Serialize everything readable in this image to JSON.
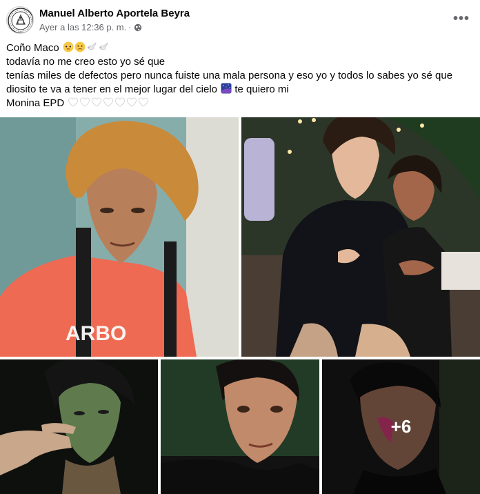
{
  "post": {
    "author": "Manuel Alberto Aportela Beyra",
    "timestamp": "Ayer a las 12:36 p. m.",
    "separator": "·",
    "privacy_icon": "globe-icon",
    "more_icon": "more-options-icon",
    "more_label": "•••"
  },
  "caption": {
    "line1": "Coño Maco",
    "line1_emojis": [
      "pleading-face-emoji",
      "sad-face-emoji",
      "dove-emoji",
      "dove-emoji"
    ],
    "line2": "todavía no me creo esto yo sé que",
    "line3": "tenías miles de defectos pero nunca fuiste una mala persona y eso yo y todos lo sabes yo sé que",
    "line4": "diosito te va a tener en el mejor lugar del cielo",
    "line4_emoji": "night-sky-emoji",
    "line4_tail": "te quiero mi",
    "line5": "Monina EPD",
    "line5_hearts": 7
  },
  "photos": {
    "items": [
      {
        "name": "photo-1",
        "subject": "man-orange-shirt-curly-blond-hair"
      },
      {
        "name": "photo-2",
        "subject": "two-men-posing-at-night"
      },
      {
        "name": "photo-3",
        "subject": "man-hand-gesture-dark"
      },
      {
        "name": "photo-4",
        "subject": "man-closeup-black-shirt"
      },
      {
        "name": "photo-5",
        "subject": "man-portrait-with-overlay"
      }
    ],
    "more_count": "+6"
  },
  "colors": {
    "text_primary": "#050505",
    "text_secondary": "#65676b",
    "background": "#ffffff"
  }
}
